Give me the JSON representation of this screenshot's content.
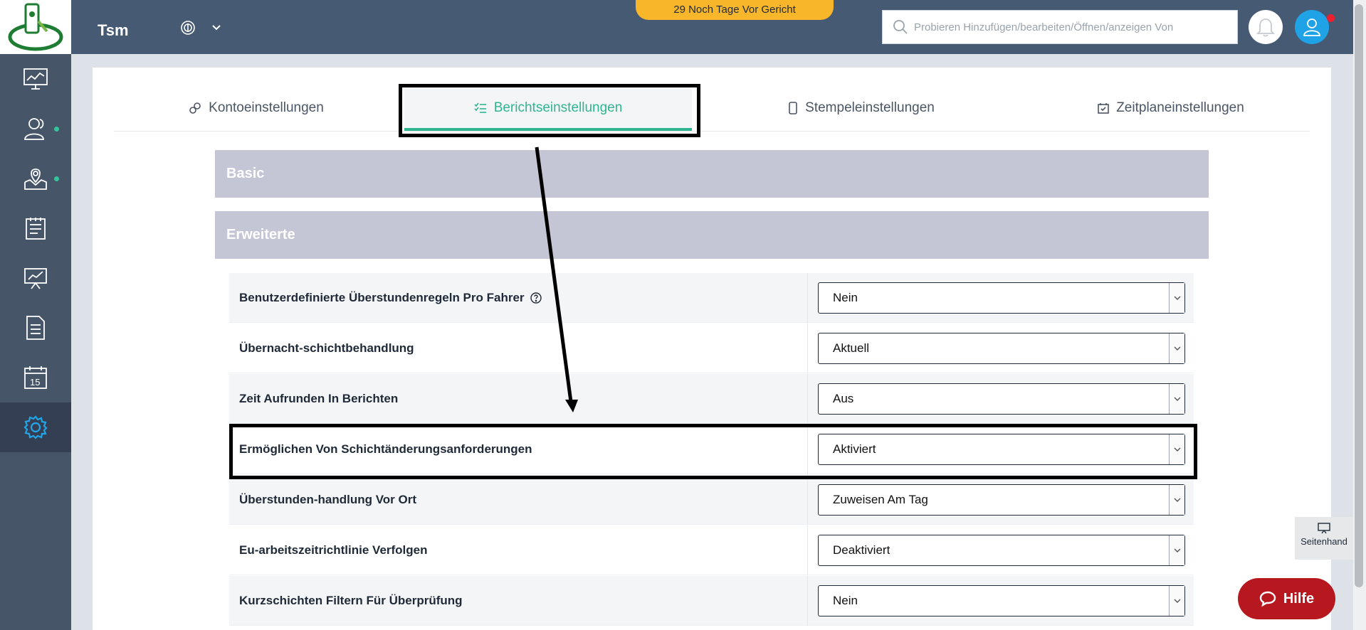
{
  "header": {
    "app_name": "Tsm",
    "countdown_banner": "29 Noch Tage Vor Gericht",
    "search_placeholder": "Probieren Hinzufügen/bearbeiten/Öffnen/anzeigen Von"
  },
  "sidebar": {
    "items": [
      {
        "icon": "monitor-chart-icon"
      },
      {
        "icon": "users-icon",
        "has_dot": true
      },
      {
        "icon": "map-pin-icon",
        "has_dot": true
      },
      {
        "icon": "report-clipboard-icon"
      },
      {
        "icon": "presentation-chart-icon"
      },
      {
        "icon": "document-icon"
      },
      {
        "icon": "calendar-icon",
        "text": "15"
      },
      {
        "icon": "gear-icon",
        "active": true
      }
    ]
  },
  "tabs": [
    {
      "label": "Kontoeinstellungen",
      "icon": "link-icon",
      "active": false
    },
    {
      "label": "Berichtseinstellungen",
      "icon": "checklist-icon",
      "active": true
    },
    {
      "label": "Stempeleinstellungen",
      "icon": "phone-icon",
      "active": false
    },
    {
      "label": "Zeitplaneinstellungen",
      "icon": "calendar-check-icon",
      "active": false
    }
  ],
  "sections": {
    "basic": {
      "title": "Basic",
      "expanded": false
    },
    "advanced": {
      "title": "Erweiterte",
      "expanded": true
    }
  },
  "settings": [
    {
      "label": "Benutzerdefinierte Überstundenregeln Pro Fahrer",
      "value": "Nein",
      "help_icon": true
    },
    {
      "label": "Übernacht-schichtbehandlung",
      "value": "Aktuell"
    },
    {
      "label": "Zeit Aufrunden In Berichten",
      "value": "Aus"
    },
    {
      "label": "Ermöglichen Von Schichtänderungsanforderungen",
      "value": "Aktiviert",
      "highlighted": true
    },
    {
      "label": "Überstunden-handlung Vor Ort",
      "value": "Zuweisen Am Tag"
    },
    {
      "label": "Eu-arbeitszeitrichtlinie Verfolgen",
      "value": "Deaktiviert"
    },
    {
      "label": "Kurzschichten Filtern Für Überprüfung",
      "value": "Nein"
    }
  ],
  "side_widget": {
    "label": "Seitenhand"
  },
  "help_button": {
    "label": "Hilfe"
  },
  "colors": {
    "accent": "#2fb592",
    "topbar": "#475a73",
    "sidebar": "#475569",
    "banner": "#f8b62b",
    "help": "#b7171f"
  }
}
